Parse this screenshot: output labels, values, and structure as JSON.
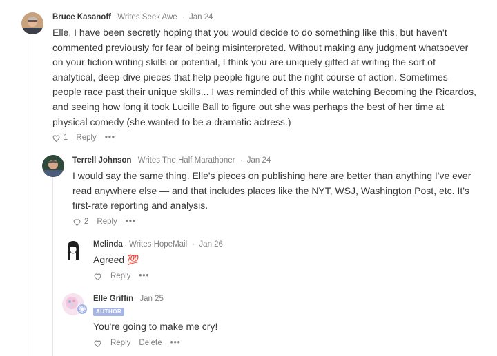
{
  "comments": [
    {
      "author": "Bruce Kasanoff",
      "byline": "Writes Seek Awe",
      "date": "Jan 24",
      "lines": [
        "Elle, I have been secretly hoping that you would decide to do something like this, but haven't",
        "commented previously for fear of being misinterpreted. Without making any judgment whatsoever",
        "on your fiction writing skills or potential, I think you are uniquely gifted at writing the sort of",
        "analytical, deep-dive pieces that help people figure out the right course of action. Sometimes",
        "people race past their unique skills... I was reminded of this while watching Becoming the Ricardos,",
        "and seeing how long it took Lucille Ball to figure out she was perhaps the best of her time at",
        "physical comedy (she wanted to be a dramatic actress.)"
      ],
      "likes": "1",
      "reply": "Reply",
      "more": "•••"
    },
    {
      "author": "Terrell Johnson",
      "byline": "Writes The Half Marathoner",
      "date": "Jan 24",
      "lines": [
        "I would say the same thing. Elle's pieces on publishing here are better than anything I've ever",
        "read anywhere else — and that includes places like the NYT, WSJ, Washington Post, etc. It's",
        "first-rate reporting and analysis."
      ],
      "likes": "2",
      "reply": "Reply",
      "more": "•••"
    },
    {
      "author": "Melinda",
      "byline": "Writes HopeMail",
      "date": "Jan 26",
      "lines": [
        "Agreed 💯"
      ],
      "likes": "",
      "reply": "Reply",
      "more": "•••"
    },
    {
      "author": "Elle Griffin",
      "byline": "",
      "date": "Jan 25",
      "badge": "AUTHOR",
      "lines": [
        "You're going to make me cry!"
      ],
      "likes": "",
      "reply": "Reply",
      "delete": "Delete",
      "more": "•••"
    }
  ],
  "colors": {
    "text": "#363737",
    "muted": "#808080",
    "author_badge": "#a6b5e5",
    "thread_line": "#e6e6e6"
  }
}
